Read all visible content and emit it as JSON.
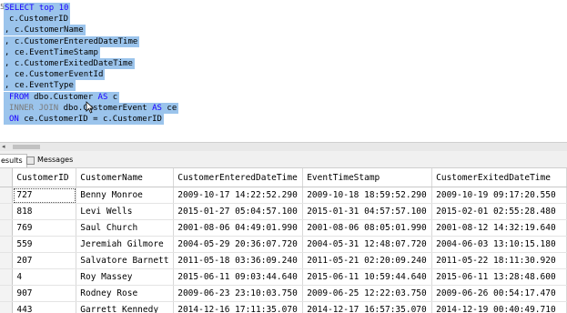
{
  "editor": {
    "lines": [
      {
        "parts": [
          {
            "t": "SELECT top 10",
            "c": "kw"
          }
        ]
      },
      {
        "parts": [
          {
            "t": "c.CustomerID",
            "c": ""
          }
        ]
      },
      {
        "parts": [
          {
            "t": ", c.CustomerName",
            "c": ""
          }
        ]
      },
      {
        "parts": [
          {
            "t": ", c.CustomerEnteredDateTime",
            "c": ""
          }
        ]
      },
      {
        "parts": [
          {
            "t": ", ce.EventTimeStamp",
            "c": ""
          }
        ]
      },
      {
        "parts": [
          {
            "t": ", c.CustomerExitedDateTime",
            "c": ""
          }
        ]
      },
      {
        "parts": [
          {
            "t": ", ce.CustomerEventId",
            "c": ""
          }
        ]
      },
      {
        "parts": [
          {
            "t": ", ce.EventType",
            "c": ""
          }
        ]
      },
      {
        "parts": [
          {
            "t": "FROM",
            "c": "kw"
          },
          {
            "t": " dbo.Customer ",
            "c": ""
          },
          {
            "t": "AS",
            "c": "kw"
          },
          {
            "t": " c",
            "c": ""
          }
        ]
      },
      {
        "parts": [
          {
            "t": "INNER JOIN",
            "c": "gray"
          },
          {
            "t": " dbo.CustomerEvent ",
            "c": ""
          },
          {
            "t": "AS",
            "c": "kw"
          },
          {
            "t": " ce",
            "c": ""
          }
        ]
      },
      {
        "parts": [
          {
            "t": "ON",
            "c": "kw"
          },
          {
            "t": " ce.CustomerID = c.CustomerID",
            "c": ""
          }
        ]
      }
    ]
  },
  "tabs": {
    "results_label": "esults",
    "messages_label": "Messages"
  },
  "grid": {
    "columns": [
      "",
      "CustomerID",
      "CustomerName",
      "CustomerEnteredDateTime",
      "EventTimeStamp",
      "CustomerExitedDateTime"
    ],
    "rows": [
      [
        "",
        "727",
        "Benny Monroe",
        "2009-10-17 14:22:52.290",
        "2009-10-18 18:59:52.290",
        "2009-10-19 09:17:20.550"
      ],
      [
        "",
        "818",
        "Levi Wells",
        "2015-01-27 05:04:57.100",
        "2015-01-31 04:57:57.100",
        "2015-02-01 02:55:28.480"
      ],
      [
        "",
        "769",
        "Saul Church",
        "2001-08-06 04:49:01.990",
        "2001-08-06 08:05:01.990",
        "2001-08-12 14:32:19.640"
      ],
      [
        "",
        "559",
        "Jeremiah Gilmore",
        "2004-05-29 20:36:07.720",
        "2004-05-31 12:48:07.720",
        "2004-06-03 13:10:15.180"
      ],
      [
        "",
        "207",
        "Salvatore Barnett",
        "2011-05-18 03:36:09.240",
        "2011-05-21 02:20:09.240",
        "2011-05-22 18:11:30.920"
      ],
      [
        "",
        "4",
        "Roy Massey",
        "2015-06-11 09:03:44.640",
        "2015-06-11 10:59:44.640",
        "2015-06-11 13:28:48.600"
      ],
      [
        "",
        "907",
        "Rodney Rose",
        "2009-06-23 23:10:03.750",
        "2009-06-25 12:22:03.750",
        "2009-06-26 00:54:17.470"
      ],
      [
        "",
        "443",
        "Garrett Kennedy",
        "2014-12-16 17:11:35.070",
        "2014-12-17 16:57:35.070",
        "2014-12-19 00:40:49.710"
      ]
    ]
  },
  "colors": {
    "selection": "#9bc4ec",
    "keyword": "#1a00ff"
  }
}
